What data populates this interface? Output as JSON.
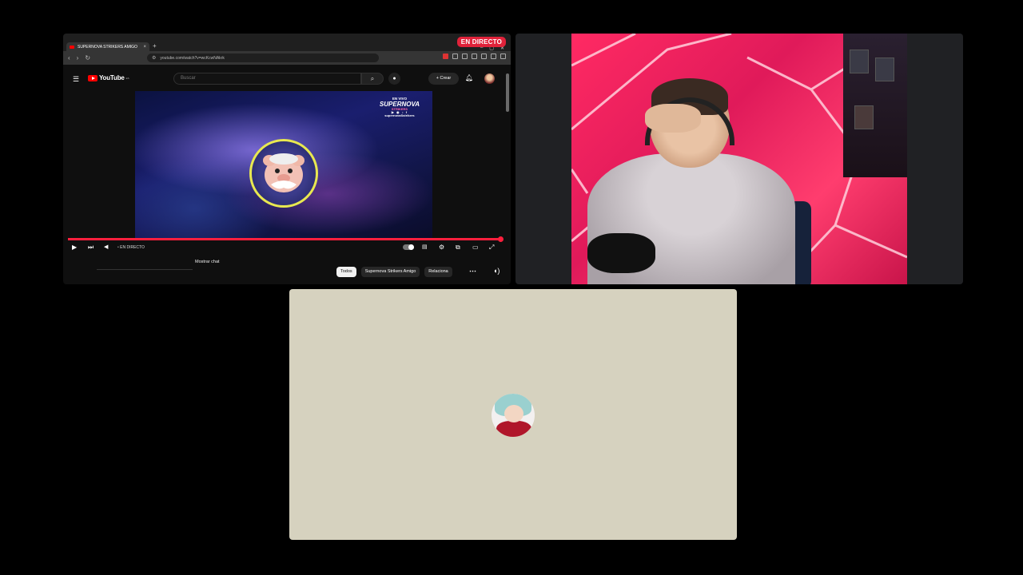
{
  "screen_share": {
    "live_badge": "EN DIRECTO",
    "browser": {
      "tab_title": "SUPERNOVA STRIKERS AMIGO",
      "tab_close": "×",
      "new_tab": "+",
      "window_controls": [
        "–",
        "▢",
        "✕"
      ],
      "url": "youtube.com/watch?v=wcKcwNAkrk"
    },
    "youtube": {
      "logo_text": "YouTube",
      "logo_region": "ES",
      "search_placeholder": "Buscar",
      "create_label": "+ Crear",
      "player": {
        "live_label": "EN DIRECTO",
        "overlay": {
          "line1": "EN VIVO",
          "line2": "SUPERNOVA",
          "tag": "STRIKERS",
          "socials": "▶ ◉ ♪ f",
          "handle": "supernovaSstrikers"
        }
      },
      "show_chat": "Mostrar chat",
      "chips": [
        "Todos",
        "Supernova Strikers Amigo",
        "Relaciona"
      ],
      "more": "⋯"
    }
  },
  "colors": {
    "live_red": "#e0223a",
    "progress_red": "#ff1f3d",
    "avatar_bg": "#d6d2bf",
    "cam_pink": "#ff2a63"
  },
  "icons": {
    "burger": "☰",
    "search": "⌕",
    "mic": "🎤",
    "bell": "🔔",
    "play": "▶",
    "next": "⏭",
    "volume": "🔊",
    "settings": "⚙",
    "miniplayer": "⧉",
    "theater": "▭",
    "fullscreen": "⛶",
    "back": "‹",
    "forward": "›",
    "reload": "↻"
  }
}
